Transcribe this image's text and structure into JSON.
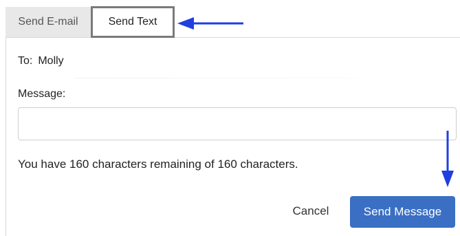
{
  "tabs": [
    {
      "label": "Send E-mail",
      "active": false
    },
    {
      "label": "Send Text",
      "active": true
    }
  ],
  "form": {
    "to_label": "To:",
    "to_value": "Molly",
    "message_label": "Message:",
    "message_value": "",
    "remaining_text": "You have 160 characters remaining of 160 characters."
  },
  "actions": {
    "cancel_label": "Cancel",
    "send_label": "Send Message"
  },
  "colors": {
    "accent": "#3a6fc4",
    "annotation_arrow": "#1f3fe0",
    "active_tab_border": "#7a7a7a",
    "inactive_tab_bg": "#e8e8e8"
  },
  "icons": [
    "arrow-left-icon",
    "arrow-down-icon"
  ]
}
